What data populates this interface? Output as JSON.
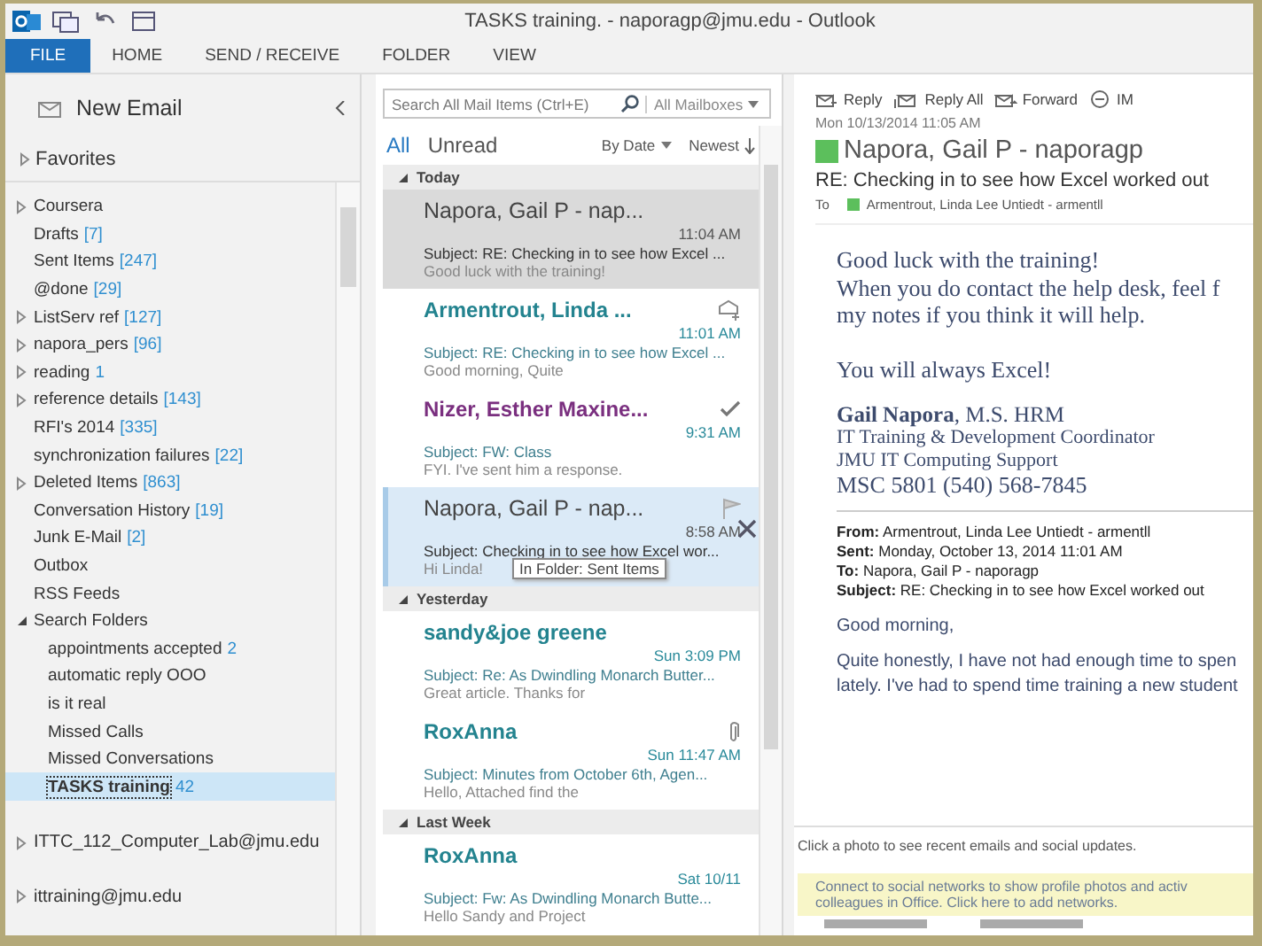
{
  "window": {
    "title": "TASKS training. - naporagp@jmu.edu - Outlook"
  },
  "ribbon_tabs": [
    {
      "label": "FILE",
      "selected": true
    },
    {
      "label": "HOME",
      "selected": false
    },
    {
      "label": "SEND / RECEIVE",
      "selected": false
    },
    {
      "label": "FOLDER",
      "selected": false
    },
    {
      "label": "VIEW",
      "selected": false
    }
  ],
  "folder_pane": {
    "new_email": "New Email",
    "favorites": "Favorites",
    "folders": [
      {
        "name": "Coursera",
        "kind": "collapsed",
        "selected": false
      },
      {
        "name": "Drafts",
        "count": "[7]",
        "kind": "leaf",
        "selected": false
      },
      {
        "name": "Sent Items",
        "count": "[247]",
        "kind": "leaf",
        "selected": false
      },
      {
        "name": "@done",
        "count": "[29]",
        "kind": "leaf",
        "selected": false
      },
      {
        "name": "ListServ ref",
        "count": "[127]",
        "kind": "collapsed",
        "selected": false
      },
      {
        "name": "napora_pers",
        "count": "[96]",
        "kind": "collapsed",
        "selected": false
      },
      {
        "name": "reading",
        "count": "1",
        "kind": "collapsed",
        "selected": false
      },
      {
        "name": "reference details",
        "count": "[143]",
        "kind": "collapsed",
        "selected": false
      },
      {
        "name": "RFI's 2014",
        "count": "[335]",
        "kind": "leaf",
        "selected": false
      },
      {
        "name": "synchronization failures",
        "count": "[22]",
        "kind": "leaf",
        "selected": false
      },
      {
        "name": "Deleted Items",
        "count": "[863]",
        "kind": "collapsed",
        "selected": false
      },
      {
        "name": "Conversation History",
        "count": "[19]",
        "kind": "leaf",
        "selected": false
      },
      {
        "name": "Junk E-Mail",
        "count": "[2]",
        "kind": "leaf",
        "selected": false
      },
      {
        "name": "Outbox",
        "kind": "leaf",
        "selected": false
      },
      {
        "name": "RSS Feeds",
        "kind": "leaf",
        "selected": false
      },
      {
        "name": "Search Folders",
        "kind": "expanded",
        "selected": false,
        "children": [
          {
            "name": "appointments accepted",
            "count": "2",
            "selected": false
          },
          {
            "name": "automatic reply OOO",
            "selected": false
          },
          {
            "name": "is it real",
            "selected": false
          },
          {
            "name": "Missed Calls",
            "selected": false
          },
          {
            "name": "Missed Conversations",
            "selected": false
          },
          {
            "name": "TASKS training",
            "count": "42",
            "selected": true
          }
        ]
      }
    ],
    "accounts": [
      {
        "name": "ITTC_112_Computer_Lab@jmu.edu",
        "kind": "collapsed"
      },
      {
        "name": "ittraining@jmu.edu",
        "kind": "collapsed"
      }
    ]
  },
  "message_list": {
    "search_placeholder": "Search All Mail Items (Ctrl+E)",
    "scope": "All Mailboxes",
    "filters": [
      {
        "label": "All",
        "selected": true
      },
      {
        "label": "Unread",
        "selected": false
      }
    ],
    "sort": "By Date",
    "order": "Newest",
    "items": [
      {
        "kind": "group_header",
        "label": "Today"
      },
      {
        "kind": "message",
        "sender": "Napora, Gail P - nap...",
        "time": "11:04 AM",
        "subject": "Subject: RE: Checking in to see how Excel ...",
        "preview": "Good luck with the training!",
        "unread": false,
        "selected": true,
        "hovered": false,
        "color": "#444444"
      },
      {
        "kind": "message",
        "sender": "Armentrout, Linda ...",
        "time": "11:01 AM",
        "subject": "Subject: RE: Checking in to see how Excel ...",
        "preview": "Good morning,  Quite",
        "unread": true,
        "selected": false,
        "hovered": false,
        "color": "#23838f"
      },
      {
        "kind": "message",
        "sender": "Nizer, Esther Maxine...",
        "time": "9:31 AM",
        "subject": "Subject: FW: Class",
        "preview": "FYI.  I've sent him a response.",
        "unread": true,
        "selected": false,
        "hovered": false,
        "color": "#7a2f7f"
      },
      {
        "kind": "message",
        "sender": "Napora, Gail P - nap...",
        "time": "8:58 AM",
        "subject": "Subject: Checking in to see how Excel wor...",
        "preview": "Hi Linda!",
        "unread": false,
        "selected": false,
        "hovered": true,
        "color": "#444444",
        "tooltip": "In Folder: Sent Items"
      },
      {
        "kind": "group_header",
        "label": "Yesterday"
      },
      {
        "kind": "message",
        "sender": "sandy&joe greene",
        "time": "Sun 3:09 PM",
        "subject": "Subject: Re: As Dwindling Monarch Butter...",
        "preview": "Great article.  Thanks for",
        "unread": true,
        "selected": false,
        "hovered": false,
        "color": "#23838f"
      },
      {
        "kind": "message",
        "sender": "RoxAnna",
        "time": "Sun 11:47 AM",
        "subject": "Subject: Minutes from October 6th, Agen...",
        "preview": "Hello,  Attached find the",
        "unread": true,
        "selected": false,
        "hovered": false,
        "color": "#23838f"
      },
      {
        "kind": "group_header",
        "label": "Last Week"
      },
      {
        "kind": "message",
        "sender": "RoxAnna",
        "time": "Sat 10/11",
        "subject": "Subject: Fw: As Dwindling Monarch Butte...",
        "preview": "Hello Sandy and Project",
        "unread": true,
        "selected": false,
        "hovered": false,
        "color": "#23838f"
      }
    ]
  },
  "reading_pane": {
    "actions": [
      {
        "label": "Reply"
      },
      {
        "label": "Reply All"
      },
      {
        "label": "Forward"
      },
      {
        "label": "IM"
      }
    ],
    "date": "Mon 10/13/2014 11:05 AM",
    "sender": "Napora, Gail P - naporagp",
    "subject": "RE: Checking in to see how Excel worked out",
    "to_label": "To",
    "recipient": "Armentrout, Linda Lee Untiedt - armentll",
    "message_lines": [
      "Good luck with the training!",
      "When you do contact the help desk, feel f",
      "my notes if you think it will help."
    ],
    "closing": "You will always Excel!",
    "signature": [
      "**Gail Napora**, M.S. HRM",
      "IT Training & Development Coordinator",
      "JMU  IT Computing Support",
      "MSC 5801      (540) 568-7845"
    ],
    "quoted_fields": [
      {
        "label": "From:",
        "value": "Armentrout, Linda Lee Untiedt - armentll"
      },
      {
        "label": "Sent:",
        "value": "Monday, October 13, 2014 11:01 AM"
      },
      {
        "label": "To:",
        "value": "Napora, Gail P - naporagp"
      },
      {
        "label": "Subject:",
        "value": "RE: Checking in to see how Excel worked out"
      }
    ],
    "quoted_lines": [
      "Good morning,",
      "Quite honestly, I have not had enough time to spen",
      "lately. I've had to spend time training a new student"
    ],
    "people_hint": "Click a photo to see recent emails and social updates.",
    "social_notice": [
      "Connect to social networks to show profile photos and activ",
      "colleagues in Office. Click here to add networks."
    ]
  }
}
